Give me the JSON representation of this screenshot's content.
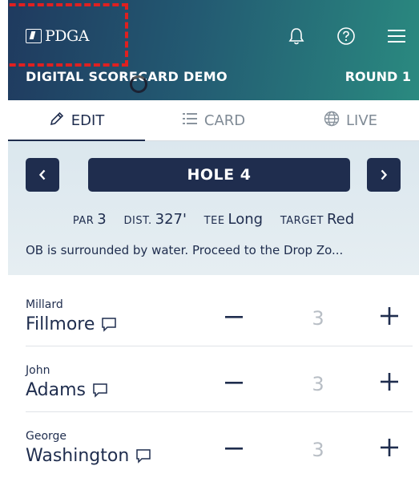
{
  "header": {
    "logo_text": "PDGA",
    "subtitle": "DIGITAL SCORECARD DEMO",
    "round": "ROUND 1"
  },
  "tabs": [
    {
      "label": "EDIT",
      "icon": "pencil-icon",
      "active": true
    },
    {
      "label": "CARD",
      "icon": "list-icon",
      "active": false
    },
    {
      "label": "LIVE",
      "icon": "globe-icon",
      "active": false
    }
  ],
  "hole": {
    "title": "HOLE 4",
    "par_label": "PAR",
    "par": "3",
    "dist_label": "DIST.",
    "dist": "327'",
    "tee_label": "TEE",
    "tee": "Long",
    "target_label": "TARGET",
    "target": "Red",
    "note": "OB is surrounded by water. Proceed to the Drop Zo..."
  },
  "players": [
    {
      "first": "Millard",
      "last": "Fillmore",
      "score": "3"
    },
    {
      "first": "John",
      "last": "Adams",
      "score": "3"
    },
    {
      "first": "George",
      "last": "Washington",
      "score": "3"
    }
  ],
  "colors": {
    "navy": "#1f2d4e",
    "header_start": "#1f3a5f",
    "header_end": "#2a8a80",
    "highlight": "#e02020"
  }
}
